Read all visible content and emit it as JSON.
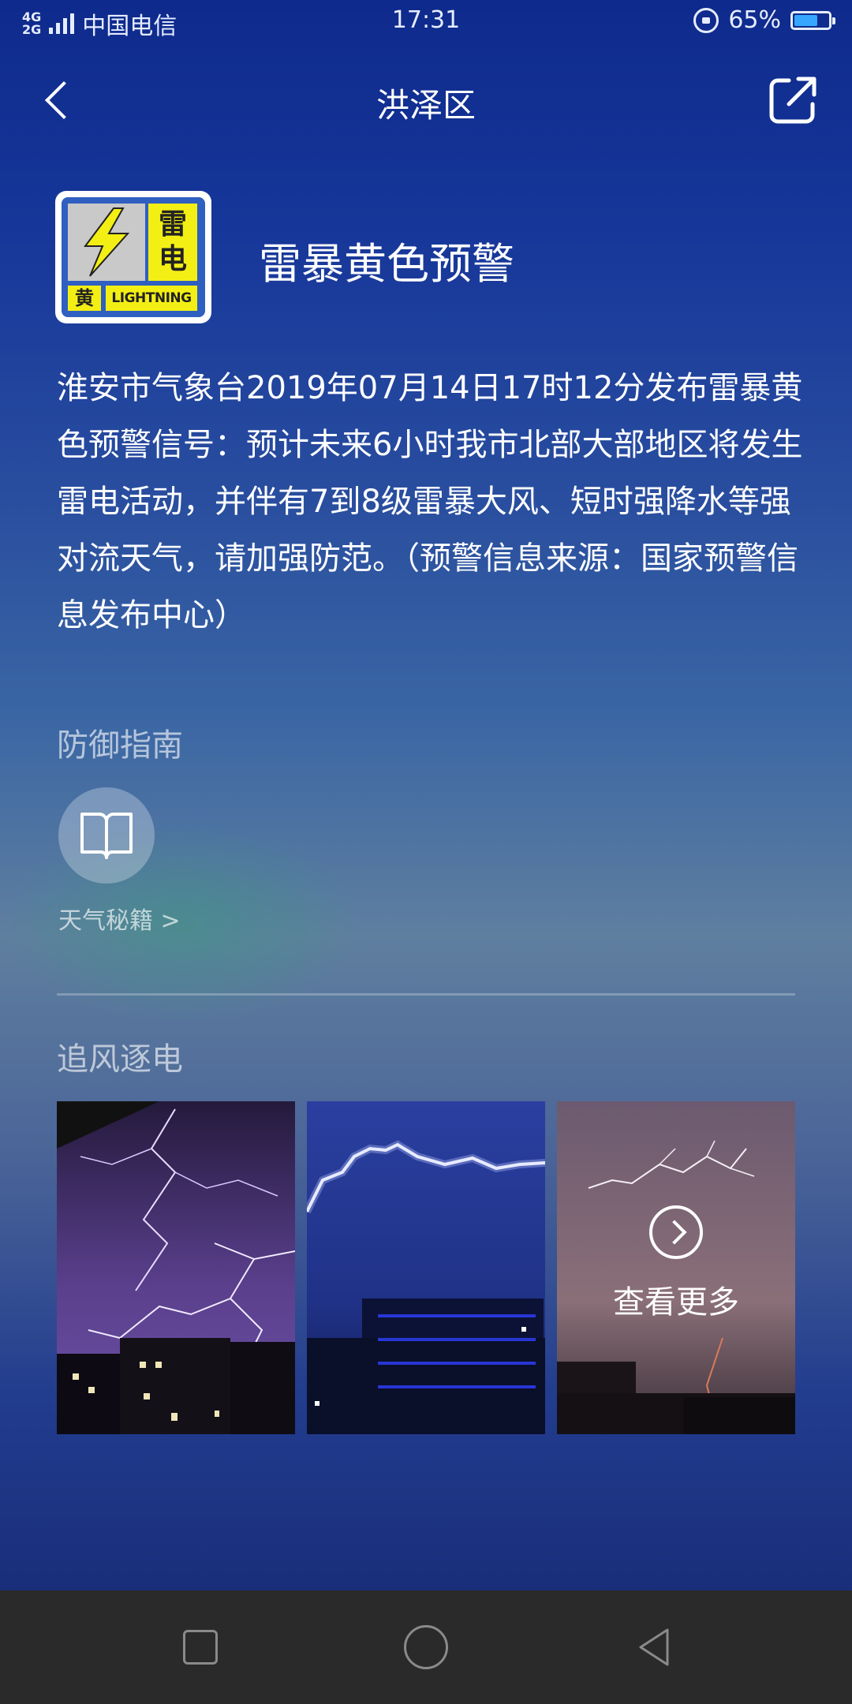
{
  "status_bar": {
    "network": "4G\n2G",
    "carrier": "中国电信",
    "time": "17:31",
    "battery": "65%",
    "battery_level": 0.65
  },
  "header": {
    "title": "洪泽区"
  },
  "warning": {
    "badge_text_cn": [
      "雷",
      "电"
    ],
    "badge_level": "黄",
    "badge_text_en": "LIGHTNING",
    "title": "雷暴黄色预警",
    "description": "淮安市气象台2019年07月14日17时12分发布雷暴黄色预警信号：预计未来6小时我市北部大部地区将发生雷电活动，并伴有7到8级雷暴大风、短时强降水等强对流天气，请加强防范。（预警信息来源：国家预警信息发布中心）",
    "colors": {
      "badge_bg": "#2f5fc0",
      "yellow": "#f3ef14"
    }
  },
  "guide": {
    "section_title": "防御指南",
    "icon": "book-icon",
    "link_label": "天气秘籍 >"
  },
  "storm_chasing": {
    "section_title": "追风逐电",
    "photos": [
      {
        "name": "lightning-photo-purple"
      },
      {
        "name": "lightning-photo-blue"
      },
      {
        "name": "lightning-photo-more",
        "more_label": "查看更多"
      }
    ]
  },
  "nav_bar": {
    "buttons": [
      "recent-apps-icon",
      "home-icon",
      "back-triangle-icon"
    ]
  }
}
